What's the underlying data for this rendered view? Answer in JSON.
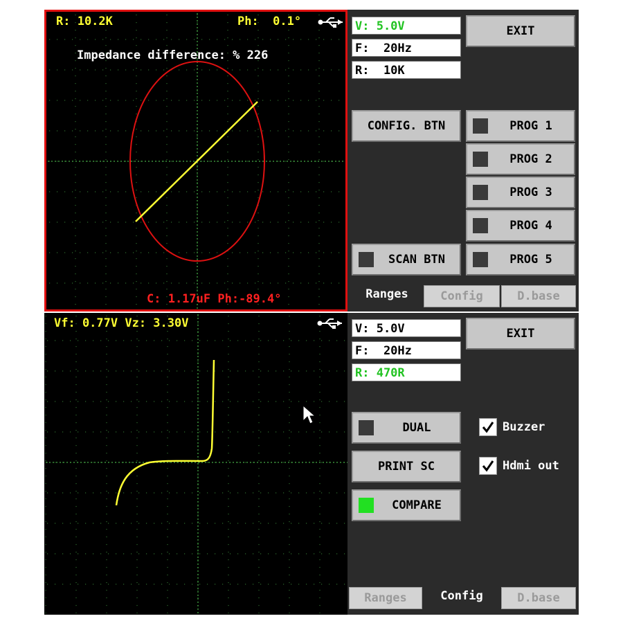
{
  "top": {
    "scope": {
      "r_readout": "R: 10.2K",
      "ph_readout": "Ph:  0.1°",
      "impedance_text": "Impedance difference: % 226",
      "bottom_readout": "C: 1.17uF Ph:-89.4°",
      "trace_color": "#ffff33",
      "ellipse_color": "#dd1111",
      "border_color": "#e01010"
    },
    "fields": {
      "v": "V: 5.0V",
      "f": "F:  20Hz",
      "r": "R:  10K"
    },
    "exit_label": "EXIT",
    "config_btn_label": "CONFIG. BTN",
    "scan_btn_label": "SCAN BTN",
    "progs": [
      "PROG 1",
      "PROG 2",
      "PROG 3",
      "PROG 4",
      "PROG 5"
    ],
    "tabs": {
      "ranges": "Ranges",
      "config": "Config",
      "dbase": "D.base"
    }
  },
  "bottom": {
    "scope": {
      "readout": "Vf: 0.77V Vz: 3.30V",
      "trace_color": "#ffff33"
    },
    "fields": {
      "v": "V: 5.0V",
      "f": "F:  20Hz",
      "r": "R: 470R"
    },
    "exit_label": "EXIT",
    "dual_label": "DUAL",
    "print_label": "PRINT SC",
    "compare_label": "COMPARE",
    "buzzer_label": "Buzzer",
    "hdmi_label": "Hdmi out",
    "tabs": {
      "ranges": "Ranges",
      "config": "Config",
      "dbase": "D.base"
    }
  },
  "colors": {
    "accent_green": "#22e022",
    "readout_yellow": "#ffff33"
  },
  "icons": [
    "usb-icon",
    "cursor-icon",
    "check-icon"
  ]
}
